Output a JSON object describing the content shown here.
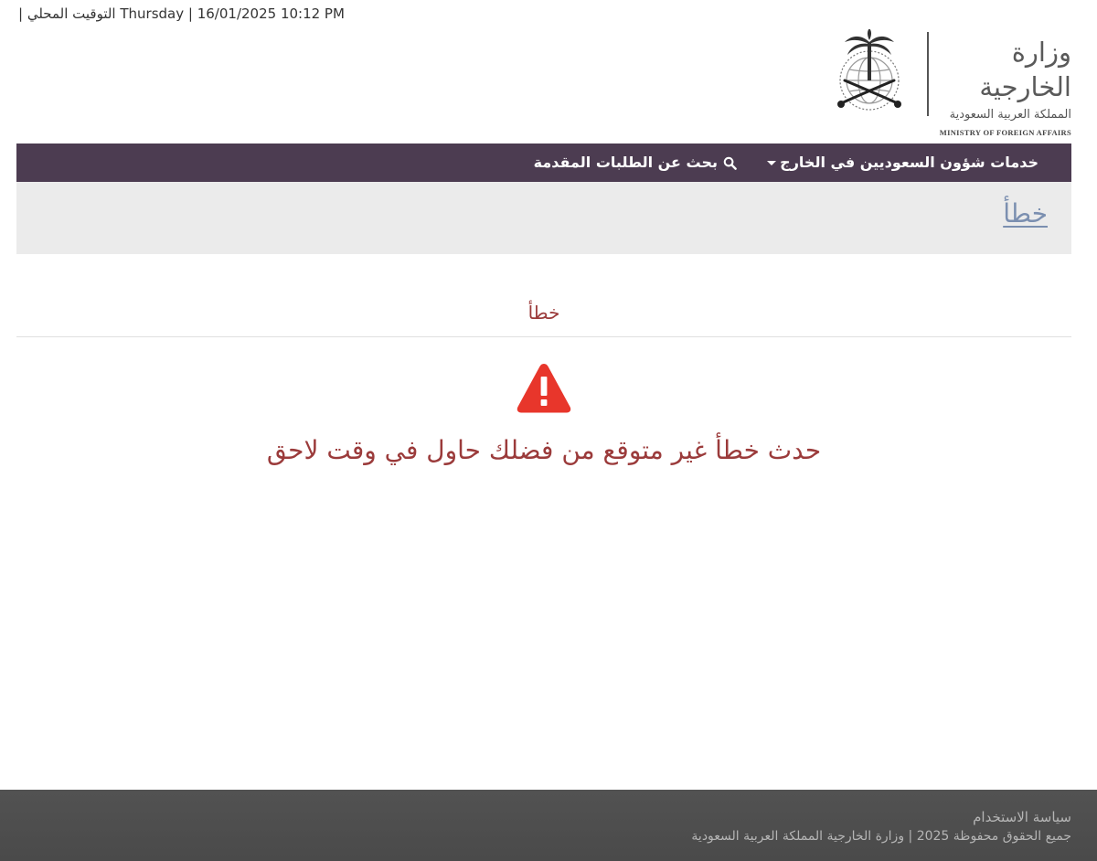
{
  "topbar": {
    "datetime_text": "| التوقيت المحلي Thursday | 16/01/2025 10:12 PM"
  },
  "logo": {
    "arabic_name": "وزارة الخارجية",
    "arabic_subtitle": "المملكة العربية السعودية",
    "english_name": "MINISTRY OF FOREIGN AFFAIRS"
  },
  "nav": {
    "items": [
      {
        "label": "خدمات شؤون السعوديين في الخارج",
        "icon": "caret-down-icon"
      },
      {
        "label": "بحث عن الطلبات المقدمة",
        "icon": "search-icon"
      }
    ]
  },
  "page_header": {
    "title": "خطأ"
  },
  "content": {
    "section_title": "خطأ",
    "error_icon": "warning-triangle-icon",
    "error_message": "حدث خطأ غير متوقع من فضلك حاول في وقت لاحق"
  },
  "footer": {
    "terms_link": "سياسة الاستخدام",
    "copyright": "جميع الحقوق محفوظة 2025 | وزارة الخارجية المملكة العربية السعودية"
  },
  "colors": {
    "nav_bg": "#4c3c51",
    "header_bg": "#ebebeb",
    "title_link": "#7b8fb0",
    "error_text": "#9b3b3b",
    "warning_red": "#e8362b",
    "footer_bg": "#4e4e4e"
  }
}
